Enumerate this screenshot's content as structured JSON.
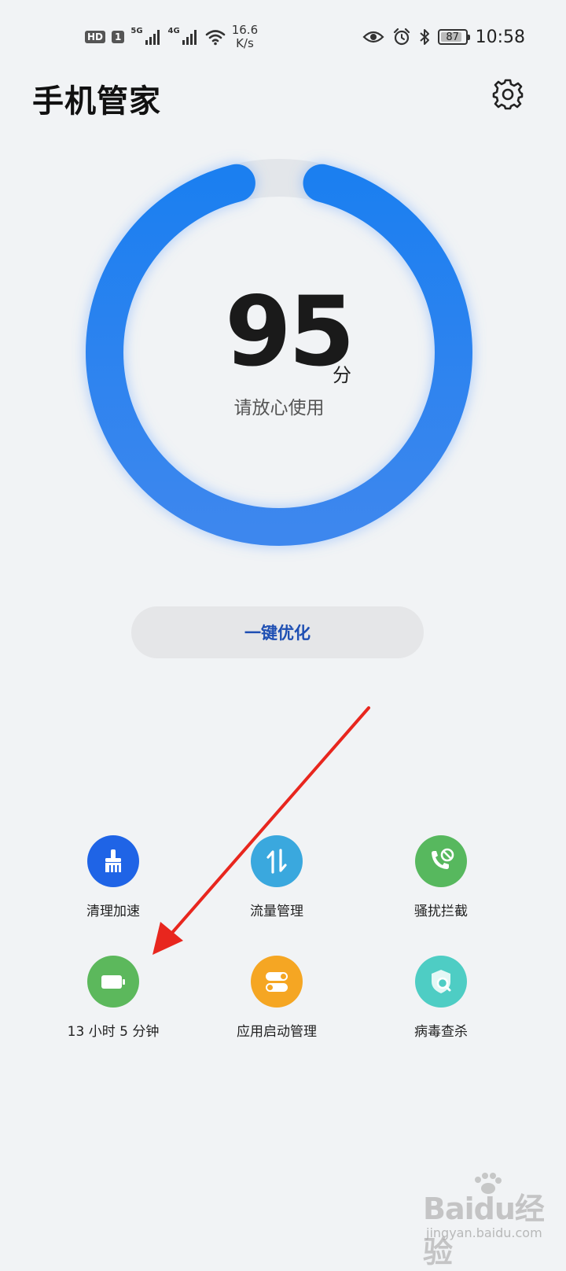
{
  "status_bar": {
    "hd": "HD",
    "sim": "1",
    "net1": "5G",
    "net2": "4G",
    "speed_value": "16.6",
    "speed_unit": "K/s",
    "battery": "87",
    "battery_level": 0.87,
    "time": "10:58"
  },
  "header": {
    "title": "手机管家",
    "settings_icon": "gear-icon"
  },
  "score": {
    "value": "95",
    "unit": "分",
    "status": "请放心使用",
    "progress": 0.95,
    "ring_colors": [
      "#1b7ff0",
      "#4a8ef0"
    ]
  },
  "optimize_button": "一键优化",
  "tools": [
    {
      "label": "清理加速",
      "icon": "broom-icon",
      "color": "#1f64e6"
    },
    {
      "label": "流量管理",
      "icon": "data-transfer-icon",
      "color": "#3aa8de"
    },
    {
      "label": "骚扰拦截",
      "icon": "call-block-icon",
      "color": "#57b85e"
    },
    {
      "label": "13 小时 5 分钟",
      "icon": "battery-icon",
      "color": "#5cb85c"
    },
    {
      "label": "应用启动管理",
      "icon": "toggle-switches-icon",
      "color": "#f5a623"
    },
    {
      "label": "病毒查杀",
      "icon": "shield-scan-icon",
      "color": "#4ecdc4"
    }
  ],
  "watermark": {
    "brand": "Baidu经验",
    "url": "jingyan.baidu.com"
  }
}
